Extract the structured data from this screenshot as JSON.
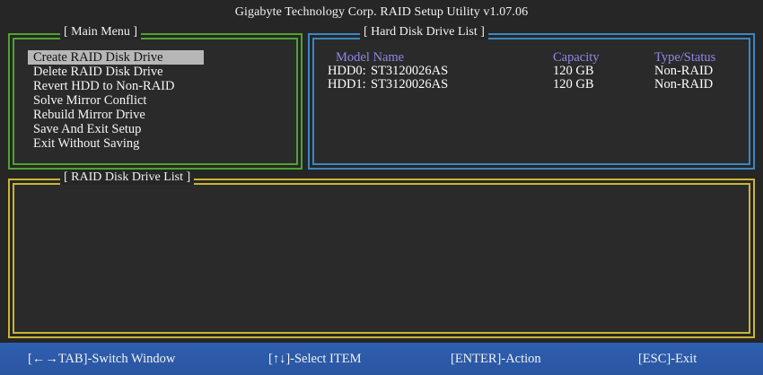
{
  "title": "Gigabyte Technology Corp.  RAID Setup Utility  v1.07.06",
  "main_menu": {
    "legend": "[ Main Menu ]",
    "items": [
      {
        "label": "Create RAID Disk Drive"
      },
      {
        "label": "Delete RAID Disk Drive"
      },
      {
        "label": "Revert HDD to Non-RAID"
      },
      {
        "label": "Solve Mirror Conflict"
      },
      {
        "label": "Rebuild Mirror Drive"
      },
      {
        "label": "Save And Exit Setup"
      },
      {
        "label": "Exit Without Saving"
      }
    ],
    "selected_index": 0
  },
  "hdd_list": {
    "legend": "[ Hard Disk Drive List ]",
    "headers": {
      "model": "Model Name",
      "capacity": "Capacity",
      "status": "Type/Status"
    },
    "rows": [
      {
        "id": "HDD0:",
        "model": "ST3120026AS",
        "capacity": "120 GB",
        "status": "Non-RAID"
      },
      {
        "id": "HDD1:",
        "model": "ST3120026AS",
        "capacity": "120 GB",
        "status": "Non-RAID"
      }
    ]
  },
  "raid_list": {
    "legend": "[ RAID Disk Drive List ]",
    "rows": []
  },
  "footer": {
    "switch": "[←→TAB]-Switch Window",
    "select": "[↑↓]-Select ITEM",
    "action": "[ENTER]-Action",
    "exit": "[ESC]-Exit"
  },
  "colors": {
    "main_menu_border": "#4fa32e",
    "hdd_border": "#3b86c2",
    "raid_border": "#c9b531",
    "header_text": "#8e88e8",
    "footer_bg": "#2f5fb0",
    "selection_bg": "#b7b7b7"
  }
}
